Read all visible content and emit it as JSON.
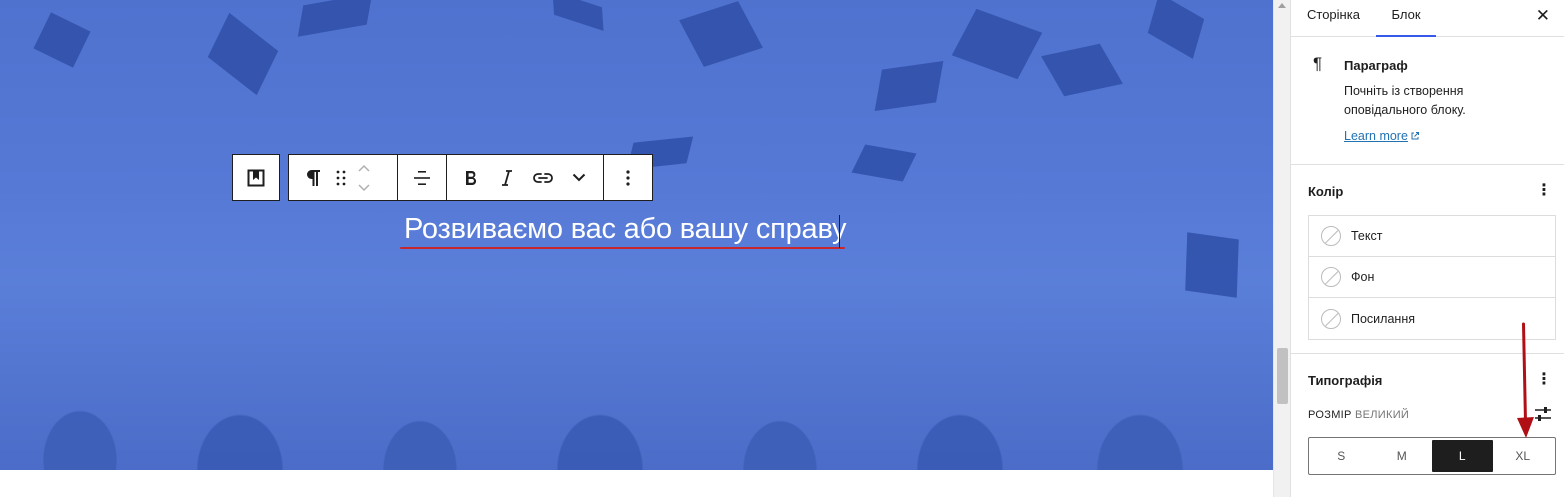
{
  "canvas": {
    "heading_text": "Розвиваємо вас або вашу справу"
  },
  "toolbar": {
    "parent_icon": "bookmark-block-icon",
    "paragraph_icon": "pilcrow-icon",
    "drag_icon": "drag-handle-icon",
    "move_up_icon": "chevron-up-icon",
    "move_down_icon": "chevron-down-icon",
    "align_icon": "align-center-icon",
    "bold_icon": "bold-icon",
    "italic_icon": "italic-icon",
    "link_icon": "link-icon",
    "more_format_icon": "chevron-down-icon",
    "options_icon": "more-vertical-icon"
  },
  "sidebar": {
    "tabs": [
      {
        "label": "Сторінка",
        "active": false
      },
      {
        "label": "Блок",
        "active": true
      }
    ],
    "close_icon": "close-icon",
    "block_card": {
      "icon": "pilcrow-icon",
      "title": "Параграф",
      "description": "Почніть із створення оповідального блоку.",
      "learn_more": "Learn more"
    },
    "color_panel": {
      "title": "Колір",
      "items": [
        {
          "label": "Текст"
        },
        {
          "label": "Фон"
        },
        {
          "label": "Посилання"
        }
      ]
    },
    "typography_panel": {
      "title": "Типографія",
      "size_label": "Розмір",
      "size_value": "Великий",
      "sizes": [
        {
          "label": "S",
          "active": false
        },
        {
          "label": "M",
          "active": false
        },
        {
          "label": "L",
          "active": true
        },
        {
          "label": "XL",
          "active": false
        }
      ]
    }
  },
  "colors": {
    "hero_blue": "#5679d6",
    "accent": "#3858e9",
    "annotation_red": "#b01015",
    "spellcheck_red": "#c9252c"
  }
}
